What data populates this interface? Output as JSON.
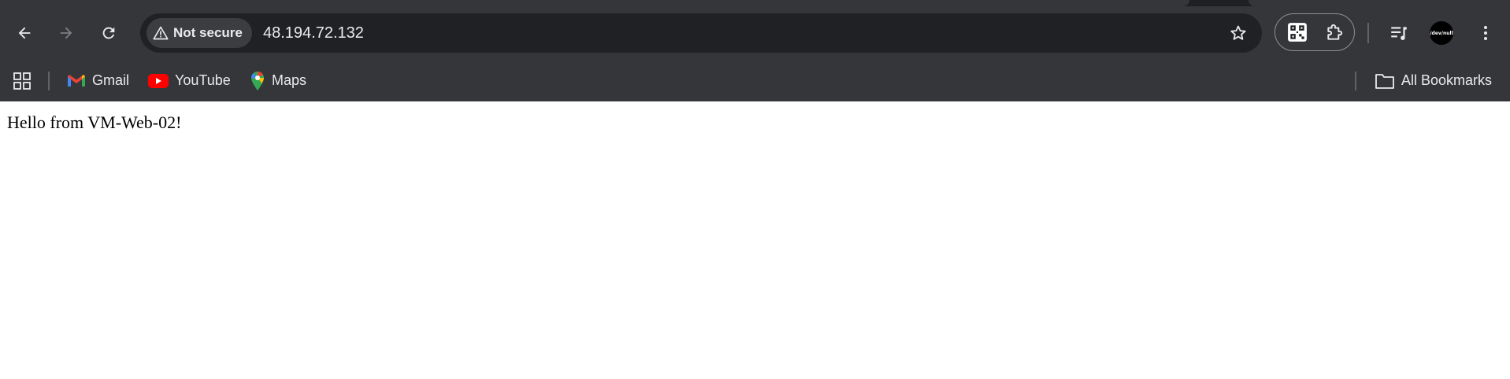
{
  "browser": {
    "security_chip": {
      "label": "Not secure",
      "icon": "warning-triangle-icon"
    },
    "url": "48.194.72.132",
    "toolbar_icons": [
      "back-icon",
      "forward-icon",
      "reload-icon",
      "star-icon",
      "qr-code-icon",
      "extensions-icon",
      "reading-list-icon",
      "menu-icon"
    ],
    "avatar_text": "/dev/null"
  },
  "bookmarks": {
    "items": [
      {
        "label": "Gmail",
        "icon": "gmail-icon"
      },
      {
        "label": "YouTube",
        "icon": "youtube-icon"
      },
      {
        "label": "Maps",
        "icon": "maps-icon"
      }
    ],
    "all_bookmarks_label": "All Bookmarks"
  },
  "page": {
    "body_text": "Hello from VM-Web-02!"
  },
  "colors": {
    "toolbar_bg": "#35363a",
    "omnibox_bg": "#202124",
    "text_light": "#e8eaed",
    "page_bg": "#ffffff"
  }
}
